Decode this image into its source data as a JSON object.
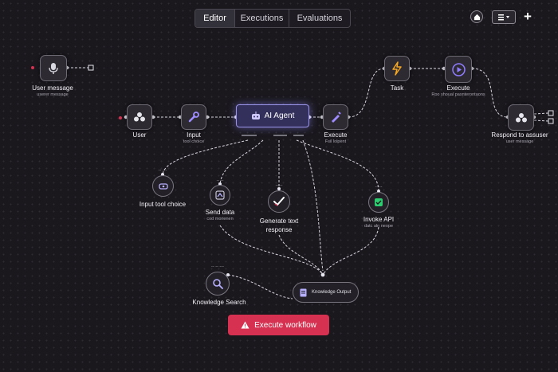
{
  "tabs": [
    {
      "label": "Editor",
      "active": true
    },
    {
      "label": "Executions"
    },
    {
      "label": "Evaluations"
    }
  ],
  "nodes": {
    "user_message": {
      "label": "User message",
      "sub": "userer message"
    },
    "user": {
      "label": "User"
    },
    "input": {
      "label": "Input",
      "sub": "tool choice"
    },
    "agent": {
      "label": "AI Agent"
    },
    "execute_mid": {
      "label": "Execute",
      "sub": "Fsil lolpent"
    },
    "task": {
      "label": "Task"
    },
    "execute_top": {
      "label": "Execute",
      "sub": "Roo shoual pasnterontaons"
    },
    "respond": {
      "label": "Respond to assuser",
      "sub": "user message"
    },
    "input_tool": {
      "label": "Input tool choice",
      "tag": "-- ---"
    },
    "send_data": {
      "label": "Send data",
      "sub": "cod morienen",
      "tag": "-- --"
    },
    "generate": {
      "label": "Generate text response",
      "tag": "-- --"
    },
    "invoke": {
      "label": "Invoke API",
      "sub": "datc aln neope",
      "tag": "-- --"
    },
    "search": {
      "label": "Knowledge Search",
      "tag": "-- -- ---"
    },
    "knowledge_output": {
      "label": "Knowledge Output"
    }
  },
  "execute_button": {
    "label": "Execute workflow"
  },
  "colors": {
    "accent": "#9a94e8",
    "execute": "#d63150",
    "task": "#f5a623",
    "execute_icon": "#8f7bff",
    "invoke": "#2ecc71"
  }
}
